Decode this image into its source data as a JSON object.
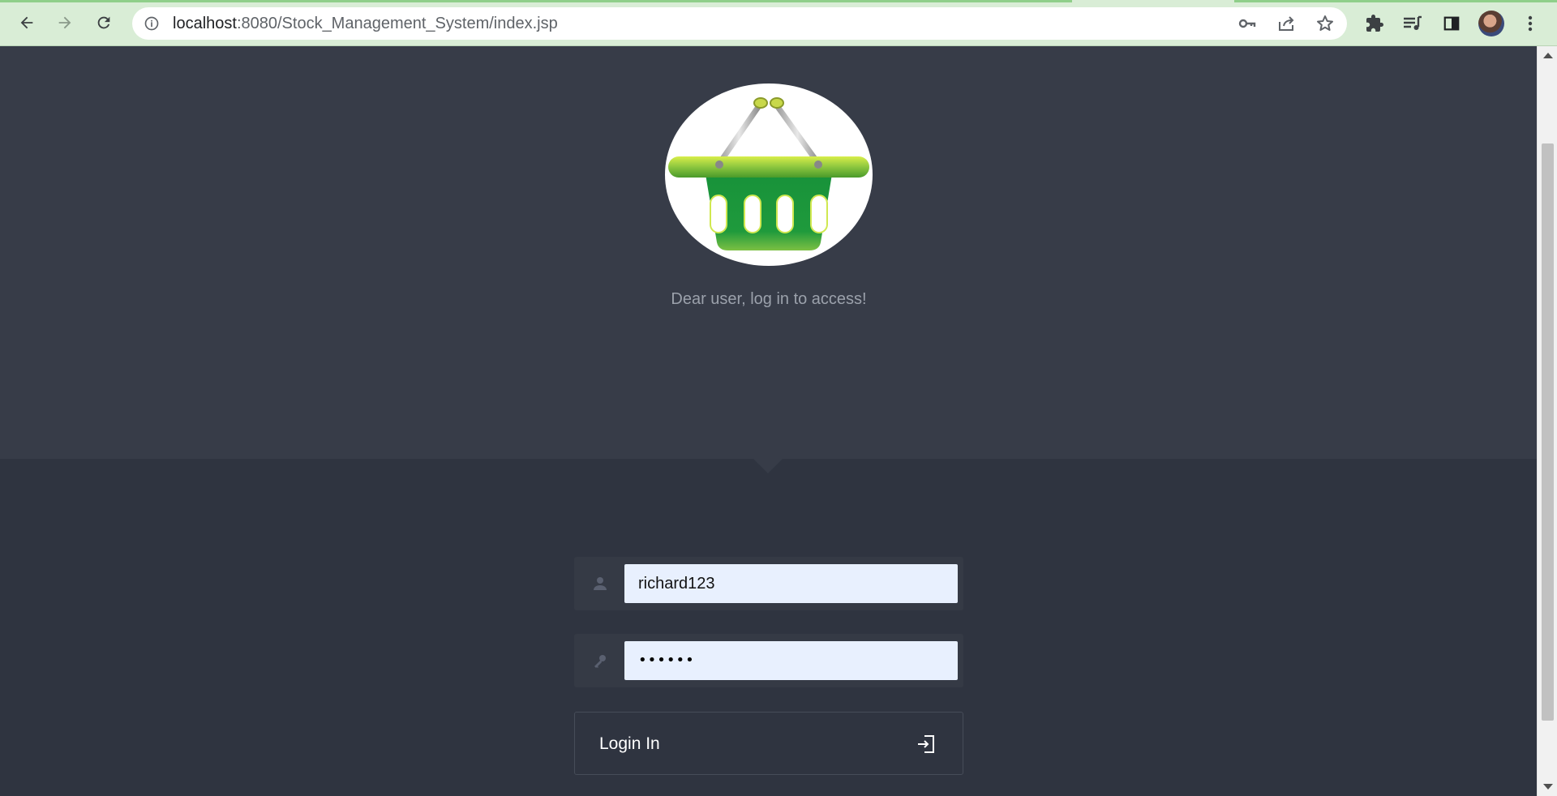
{
  "browser": {
    "url_host": "localhost",
    "url_rest": ":8080/Stock_Management_System/index.jsp",
    "icons": {
      "back": "arrow-left-icon",
      "forward": "arrow-right-icon",
      "reload": "reload-icon",
      "site_info": "info-icon",
      "password_key": "key-icon",
      "share": "share-icon",
      "bookmark": "star-icon",
      "extensions": "puzzle-icon",
      "reading_list": "playlist-icon",
      "side_panel": "side-panel-icon",
      "menu": "kebab-menu-icon"
    },
    "theme_color": "#d9edd6"
  },
  "login": {
    "tagline": "Dear user, log in to access!",
    "username_value": "richard123",
    "password_masked": "••••••",
    "button_label": "Login In",
    "icons": {
      "logo": "shopping-basket-icon",
      "username": "user-icon",
      "password": "key-icon",
      "login": "sign-in-icon"
    },
    "colors": {
      "header_bg": "#373c48",
      "body_bg": "#2f3440",
      "input_bg": "#e8f0fe",
      "basket_green": "#1f9a3c"
    }
  }
}
